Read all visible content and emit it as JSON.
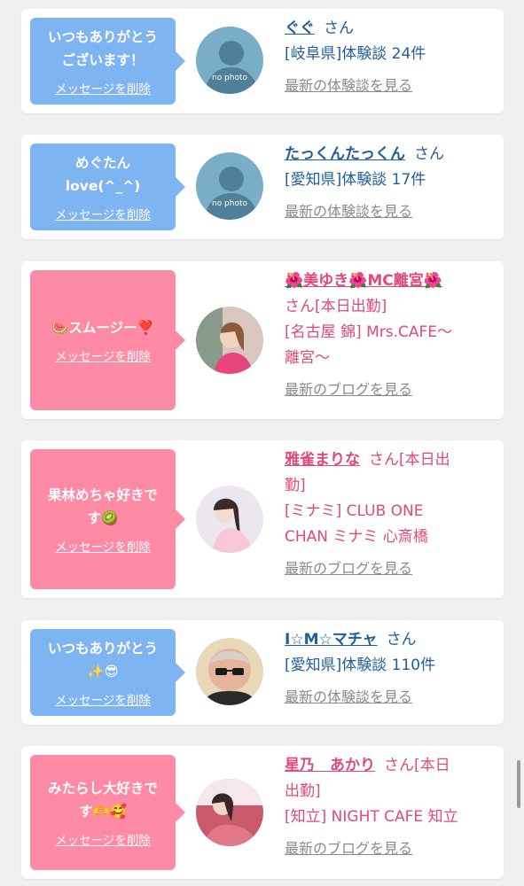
{
  "cards": [
    {
      "message": "いつもありがとう\nございます！",
      "delete_label": "メッセージを削除",
      "name": "ぐぐ",
      "suffix": "さん",
      "detail": "[岐阜県]体験談 24件",
      "view_label": "最新の体験談を見る",
      "avatar_text": "no photo",
      "theme": "blue"
    },
    {
      "message": "めぐたん\nlove(^_^)",
      "delete_label": "メッセージを削除",
      "name": "たっくんたっくん",
      "suffix": "さん",
      "detail": "[愛知県]体験談 17件",
      "view_label": "最新の体験談を見る",
      "avatar_text": "no photo",
      "theme": "blue"
    },
    {
      "message": "🍉スムージー❣️",
      "delete_label": "メッセージを削除",
      "name": "🌺美ゆき🌺MC離宮🌺",
      "suffix": "さん[本日出勤]",
      "detail": "[名古屋 錦] Mrs.CAFE〜\n離宮〜",
      "view_label": "最新のブログを見る",
      "theme": "pink"
    },
    {
      "message": "果林めちゃ好きで\nす🥝",
      "delete_label": "メッセージを削除",
      "name": "雅雀まりな",
      "suffix": "さん[本日出\n勤]",
      "detail": "[ミナミ] CLUB ONE\nCHAN ミナミ 心斎橋",
      "view_label": "最新のブログを見る",
      "theme": "pink"
    },
    {
      "message": "いつもありがとう\n✨😎",
      "delete_label": "メッセージを削除",
      "name": "I☆M☆マチャ",
      "suffix": "さん",
      "detail": "[愛知県]体験談 110件",
      "view_label": "最新の体験談を見る",
      "theme": "blue"
    },
    {
      "message": "みたらし大好きで\nす🫶🥰",
      "delete_label": "メッセージを削除",
      "name": "星乃　あかり",
      "suffix": "さん[本日\n出勤]",
      "detail": "[知立] NIGHT CAFE 知立",
      "view_label": "最新のブログを見る",
      "theme": "pink"
    }
  ]
}
